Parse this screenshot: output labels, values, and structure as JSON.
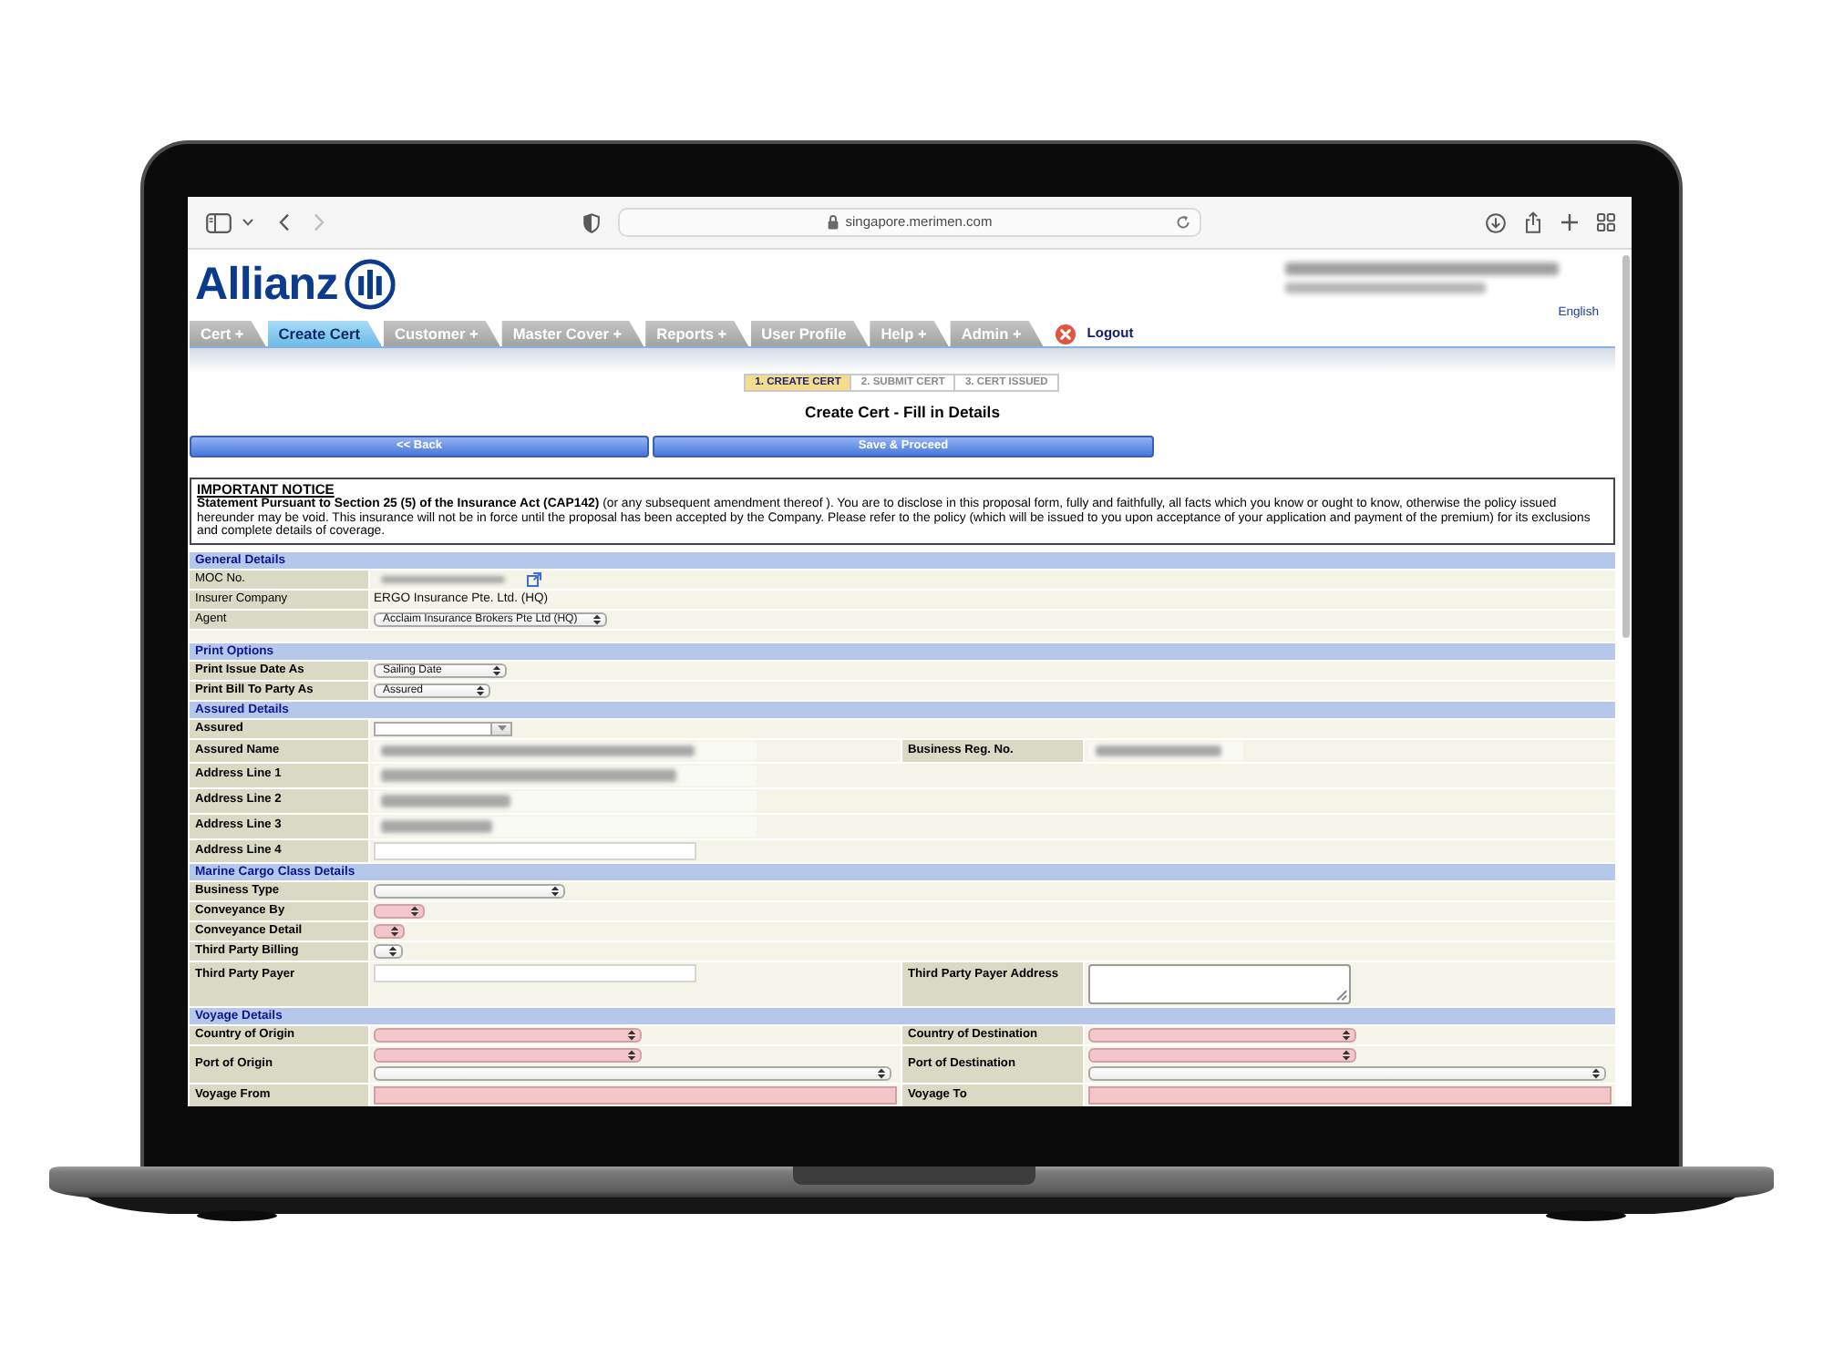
{
  "browser": {
    "url": "singapore.merimen.com",
    "can_go_forward": false
  },
  "header": {
    "brand": "Allianz",
    "account_redacted": true,
    "language": "English"
  },
  "tabs": [
    {
      "label": "Cert +",
      "selected": false
    },
    {
      "label": "Create Cert",
      "selected": true
    },
    {
      "label": "Customer +",
      "selected": false
    },
    {
      "label": "Master Cover +",
      "selected": false
    },
    {
      "label": "Reports +",
      "selected": false
    },
    {
      "label": "User Profile",
      "selected": false
    },
    {
      "label": "Help +",
      "selected": false
    },
    {
      "label": "Admin +",
      "selected": false
    }
  ],
  "logout": "Logout",
  "steps": [
    {
      "label": "1. CREATE CERT",
      "selected": true
    },
    {
      "label": "2. SUBMIT CERT",
      "selected": false
    },
    {
      "label": "3. CERT ISSUED",
      "selected": false
    }
  ],
  "page_title": "Create Cert - Fill in Details",
  "buttons": [
    {
      "label": "<< Back"
    },
    {
      "label": "Save & Proceed"
    }
  ],
  "notice": {
    "title": "IMPORTANT NOTICE",
    "text": "**Statement Pursuant to Section 25 (5) of the Insurance Act (CAP142)** (or any subsequent amendment thereof ). You are to disclose in this proposal form, fully and faithfully, all facts which you know or ought to know, otherwise the policy issued hereunder may be void. This insurance will not be in force until the proposal has been accepted by the Company. Please refer to the policy (which will be issued to you upon acceptance of your application and payment of the premium) for its exclusions and complete details of coverage."
  },
  "sections": [
    {
      "title": "General Details",
      "bold_labels": false,
      "rows": [
        {
          "kind": "fields",
          "fields": [
            {
              "label": "MOC No.",
              "controls": [
                {
                  "kind": "redacted"
                },
                {
                  "kind": "link"
                }
              ]
            }
          ]
        },
        {
          "kind": "fields",
          "fields": [
            {
              "label": "Insurer Company",
              "controls": [
                {
                  "kind": "text",
                  "value": "ERGO Insurance Pte. Ltd. (HQ)"
                }
              ]
            }
          ]
        },
        {
          "kind": "fields",
          "fields": [
            {
              "label": "Agent",
              "controls": [
                {
                  "kind": "select",
                  "value": "Acclaim Insurance Brokers Pte Ltd (HQ)",
                  "required": false
                }
              ]
            }
          ]
        },
        {
          "kind": "spacer"
        }
      ]
    },
    {
      "title": "Print Options",
      "bold_labels": true,
      "rows": [
        {
          "kind": "fields",
          "fields": [
            {
              "label": "Print Issue Date As",
              "controls": [
                {
                  "kind": "select",
                  "value": "Sailing Date",
                  "required": false
                }
              ]
            }
          ]
        },
        {
          "kind": "fields",
          "fields": [
            {
              "label": "Print Bill To Party As",
              "controls": [
                {
                  "kind": "select",
                  "value": "Assured",
                  "required": false
                }
              ]
            }
          ]
        }
      ]
    },
    {
      "title": "Assured Details",
      "bold_labels": true,
      "rows": [
        {
          "kind": "fields",
          "fields": [
            {
              "label": "Assured",
              "controls": [
                {
                  "kind": "combo",
                  "required": false
                }
              ]
            }
          ]
        },
        {
          "kind": "fields",
          "fields": [
            {
              "label": "Assured Name",
              "controls": [
                {
                  "kind": "redacted"
                }
              ]
            },
            {
              "label": "Business Reg. No.",
              "controls": [
                {
                  "kind": "redacted"
                }
              ]
            }
          ]
        },
        {
          "kind": "fields",
          "fields": [
            {
              "label": "Address Line 1",
              "controls": [
                {
                  "kind": "redacted"
                }
              ]
            }
          ]
        },
        {
          "kind": "fields",
          "fields": [
            {
              "label": "Address Line 2",
              "controls": [
                {
                  "kind": "redacted"
                }
              ]
            }
          ]
        },
        {
          "kind": "fields",
          "fields": [
            {
              "label": "Address Line 3",
              "controls": [
                {
                  "kind": "redacted"
                }
              ]
            }
          ]
        },
        {
          "kind": "fields",
          "fields": [
            {
              "label": "Address Line 4",
              "controls": [
                {
                  "kind": "input",
                  "required": false
                }
              ]
            }
          ]
        }
      ]
    },
    {
      "title": "Marine Cargo Class Details",
      "bold_labels": true,
      "rows": [
        {
          "kind": "fields",
          "fields": [
            {
              "label": "Business Type",
              "controls": [
                {
                  "kind": "select",
                  "required": false
                }
              ]
            }
          ]
        },
        {
          "kind": "fields",
          "fields": [
            {
              "label": "Conveyance By",
              "controls": [
                {
                  "kind": "select",
                  "required": true
                }
              ]
            }
          ]
        },
        {
          "kind": "fields",
          "fields": [
            {
              "label": "Conveyance Detail",
              "controls": [
                {
                  "kind": "select",
                  "required": true
                }
              ]
            }
          ]
        },
        {
          "kind": "fields",
          "fields": [
            {
              "label": "Third Party Billing",
              "controls": [
                {
                  "kind": "select",
                  "required": false
                }
              ]
            }
          ]
        },
        {
          "kind": "fields",
          "fields": [
            {
              "label": "Third Party Payer",
              "controls": [
                {
                  "kind": "input",
                  "required": false
                }
              ]
            },
            {
              "label": "Third Party Payer Address",
              "controls": [
                {
                  "kind": "textarea",
                  "required": false
                }
              ]
            }
          ]
        }
      ]
    },
    {
      "title": "Voyage Details",
      "bold_labels": true,
      "rows": [
        {
          "kind": "fields",
          "fields": [
            {
              "label": "Country of Origin",
              "controls": [
                {
                  "kind": "select",
                  "required": true
                }
              ]
            },
            {
              "label": "Country of Destination",
              "controls": [
                {
                  "kind": "select",
                  "required": true
                }
              ]
            }
          ]
        },
        {
          "kind": "fields",
          "fields": [
            {
              "label": "Port of Origin",
              "controls": [
                {
                  "kind": "select",
                  "required": true
                },
                {
                  "kind": "select",
                  "required": false
                }
              ]
            },
            {
              "label": "Port of Destination",
              "controls": [
                {
                  "kind": "select",
                  "required": true
                },
                {
                  "kind": "select",
                  "required": false
                }
              ]
            }
          ]
        },
        {
          "kind": "fields",
          "fields": [
            {
              "label": "Voyage From",
              "controls": [
                {
                  "kind": "input",
                  "required": true
                }
              ]
            },
            {
              "label": "Voyage To",
              "controls": [
                {
                  "kind": "input",
                  "required": true
                }
              ]
            }
          ]
        }
      ]
    }
  ]
}
